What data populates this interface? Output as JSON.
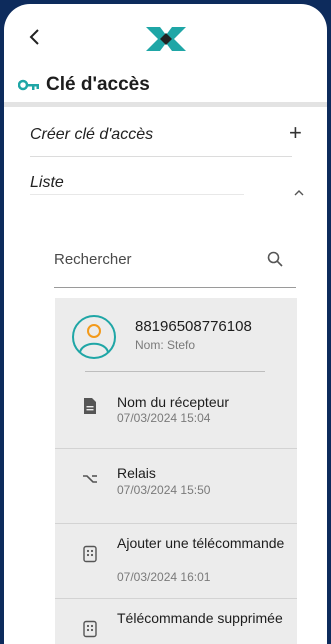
{
  "header": {
    "back_icon": "chevron-left-icon",
    "logo": "app-logo"
  },
  "section": {
    "title": "Clé d'accès",
    "icon": "key-icon",
    "accent": "#1fa6a6"
  },
  "menu": {
    "create_label": "Créer clé d'accès",
    "create_action": "+",
    "list_label": "Liste"
  },
  "search": {
    "label": "Rechercher"
  },
  "key_card": {
    "id": "88196508776108",
    "name": "Nom: Stefo",
    "events": [
      {
        "icon": "document-icon",
        "title": "Nom du récepteur",
        "date": "07/03/2024 15:04"
      },
      {
        "icon": "relay-icon",
        "title": "Relais",
        "date": "07/03/2024 15:50"
      },
      {
        "icon": "remote-icon",
        "title": "Ajouter une télécommande",
        "date": "07/03/2024 16:01"
      },
      {
        "icon": "remote-icon",
        "title": "Télécommande supprimée",
        "date": ""
      }
    ]
  },
  "colors": {
    "frame": "#0d2b5c",
    "card_bg": "#ececec",
    "accent": "#1fa6a6",
    "logo_orange": "#f39a1b"
  }
}
